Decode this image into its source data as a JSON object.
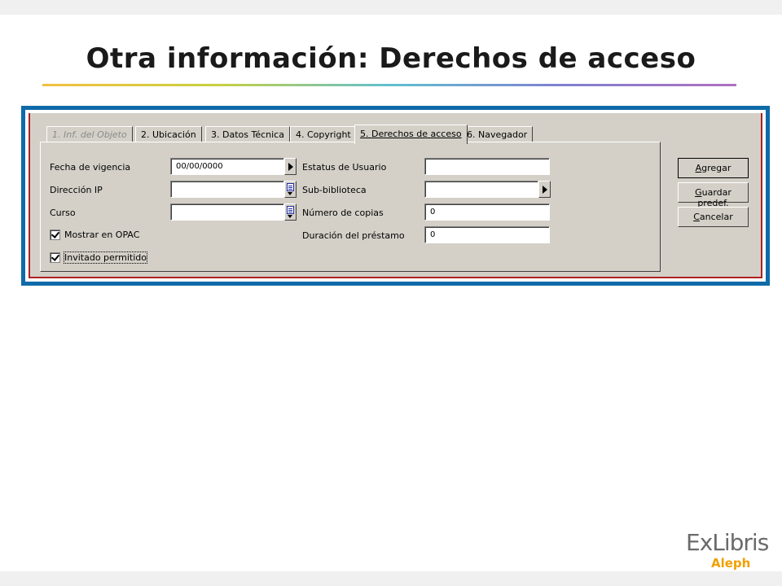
{
  "slide": {
    "title": "Otra información: Derechos de acceso"
  },
  "tabs": [
    {
      "label": "1. Inf. del Objeto",
      "state": "disabled"
    },
    {
      "label": "2. Ubicación",
      "state": "normal"
    },
    {
      "label": "3. Datos Técnica",
      "state": "normal"
    },
    {
      "label": "4. Copyright",
      "state": "normal"
    },
    {
      "label": "5. Derechos de acceso",
      "state": "active"
    },
    {
      "label": "6. Navegador",
      "state": "normal"
    }
  ],
  "form": {
    "fecha_vigencia": {
      "label": "Fecha de vigencia",
      "value": "00/00/0000"
    },
    "direccion_ip": {
      "label": "Dirección IP",
      "value": ""
    },
    "curso": {
      "label": "Curso",
      "value": ""
    },
    "mostrar_opac": {
      "label": "Mostrar en OPAC",
      "checked": true
    },
    "invitado_permitido": {
      "label": "Invitado permitido",
      "checked": true
    },
    "estatus_usuario": {
      "label": "Estatus de Usuario",
      "value": ""
    },
    "sub_biblioteca": {
      "label": "Sub-biblioteca",
      "value": ""
    },
    "numero_copias": {
      "label": "Número de copias",
      "value": "0"
    },
    "duracion_prestamo": {
      "label": "Duración del préstamo",
      "value": "0"
    }
  },
  "buttons": {
    "agregar": {
      "mnemonic": "A",
      "rest": "gregar"
    },
    "guardar_predef": {
      "mnemonic": "G",
      "rest": "uardar predef."
    },
    "cancelar": {
      "mnemonic": "C",
      "rest": "ancelar"
    }
  },
  "logo": {
    "brand": "ExLibris",
    "product": "Aleph"
  },
  "colors": {
    "frame": "#0e6aa8",
    "window": "#d4d0c8",
    "window_border": "#b02020",
    "logo_grey": "#6b6b6b",
    "logo_orange": "#f0a000"
  }
}
